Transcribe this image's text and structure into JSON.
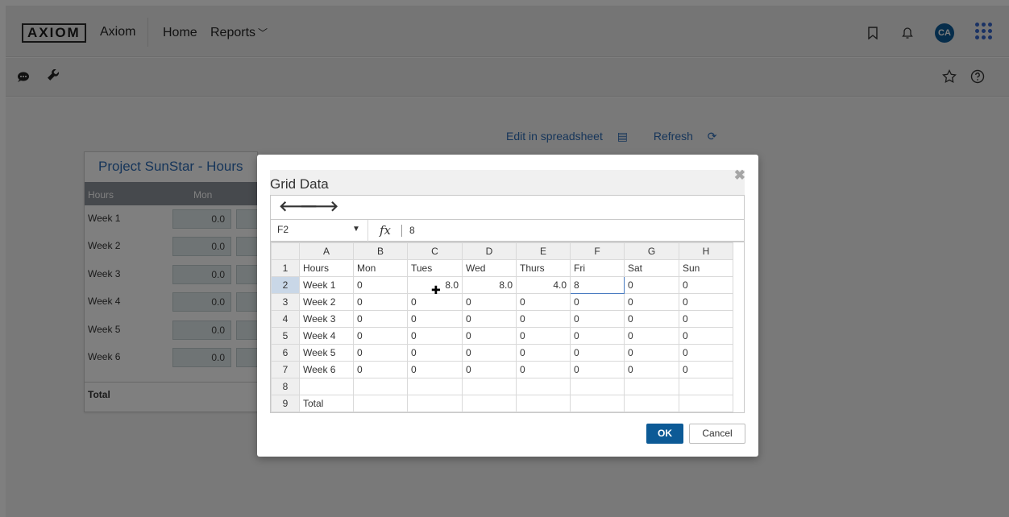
{
  "header": {
    "logo": "AXIOM",
    "brand": "Axiom",
    "nav": {
      "home": "Home",
      "reports": "Reports"
    },
    "avatar_initials": "CA",
    "icons": [
      "bookmark-icon",
      "bell-icon",
      "apps-grid-icon"
    ]
  },
  "toolbar": {
    "icons": [
      "comment-icon",
      "wrench-icon",
      "star-icon",
      "help-icon"
    ]
  },
  "top_links": {
    "edit": "Edit in spreadsheet",
    "refresh": "Refresh"
  },
  "panel": {
    "title": "Project SunStar - Hours",
    "columns": [
      "Hours",
      "Mon"
    ],
    "rows": [
      {
        "label": "Week 1",
        "mon": "0.0"
      },
      {
        "label": "Week 2",
        "mon": "0.0"
      },
      {
        "label": "Week 3",
        "mon": "0.0"
      },
      {
        "label": "Week 4",
        "mon": "0.0"
      },
      {
        "label": "Week 5",
        "mon": "0.0"
      },
      {
        "label": "Week 6",
        "mon": "0.0"
      }
    ],
    "total_label": "Total"
  },
  "dialog": {
    "title": "Grid Data",
    "name_box": "F2",
    "formula_value": "8",
    "ok_label": "OK",
    "cancel_label": "Cancel",
    "column_headers": [
      "A",
      "B",
      "C",
      "D",
      "E",
      "F",
      "G",
      "H"
    ],
    "rows": [
      {
        "n": "1",
        "cells": [
          "Hours",
          "Mon",
          "Tues",
          "Wed",
          "Thurs",
          "Fri",
          "Sat",
          "Sun"
        ]
      },
      {
        "n": "2",
        "cells": [
          "Week 1",
          "0",
          "8.0",
          "8.0",
          "4.0",
          "8",
          "0",
          "0"
        ]
      },
      {
        "n": "3",
        "cells": [
          "Week 2",
          "0",
          "0",
          "0",
          "0",
          "0",
          "0",
          "0"
        ]
      },
      {
        "n": "4",
        "cells": [
          "Week 3",
          "0",
          "0",
          "0",
          "0",
          "0",
          "0",
          "0"
        ]
      },
      {
        "n": "5",
        "cells": [
          "Week 4",
          "0",
          "0",
          "0",
          "0",
          "0",
          "0",
          "0"
        ]
      },
      {
        "n": "6",
        "cells": [
          "Week 5",
          "0",
          "0",
          "0",
          "0",
          "0",
          "0",
          "0"
        ]
      },
      {
        "n": "7",
        "cells": [
          "Week 6",
          "0",
          "0",
          "0",
          "0",
          "0",
          "0",
          "0"
        ]
      },
      {
        "n": "8",
        "cells": [
          "",
          "",
          "",
          "",
          "",
          "",
          "",
          ""
        ]
      },
      {
        "n": "9",
        "cells": [
          "Total",
          "",
          "",
          "",
          "",
          "",
          "",
          ""
        ]
      }
    ]
  },
  "colors": {
    "accent": "#0c5a96",
    "link": "#2c6bb5",
    "selection": "#c9d7e7"
  }
}
